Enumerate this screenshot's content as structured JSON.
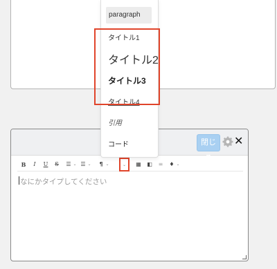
{
  "dropdown": {
    "items": [
      {
        "label": "paragraph"
      },
      {
        "label": "タイトル1"
      },
      {
        "label": "タイトル2"
      },
      {
        "label": "タイトル3"
      },
      {
        "label": "タイトル4"
      },
      {
        "label": "引用"
      },
      {
        "label": "コード"
      }
    ]
  },
  "editor": {
    "close_label": "閉じる",
    "placeholder": "なにかタイプしてください",
    "toolbar": {
      "bold": "B",
      "italic": "I",
      "underline": "U",
      "strike": "S",
      "bullet_list": "☰",
      "ordered_list": "☰",
      "heading": "¶",
      "table": "▦",
      "image": "◧",
      "align": "≡",
      "color": "♦",
      "caret": "⌄",
      "icons": [
        "bold-icon",
        "italic-icon",
        "underline-icon",
        "strikethrough-icon",
        "bullet-list-icon",
        "ordered-list-icon",
        "paragraph-icon",
        "table-icon",
        "image-icon",
        "align-icon",
        "color-icon"
      ]
    },
    "accent_close_bg": "#a9d0f2",
    "highlight_color": "#e0442a"
  }
}
